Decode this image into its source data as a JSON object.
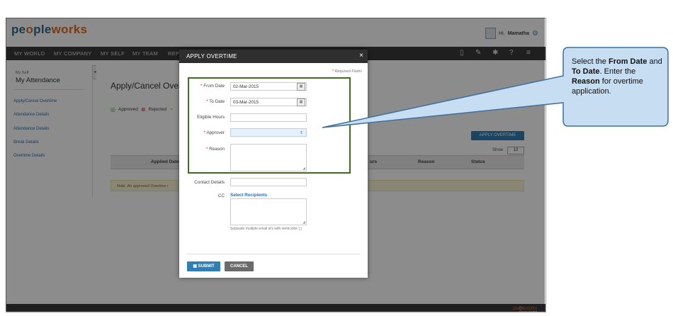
{
  "app": {
    "logo_main": "pe",
    "logo_accent": "o",
    "logo_rest": "ple",
    "logo_end": "works",
    "user_greeting": "Hi,",
    "user_name": "Mamatha"
  },
  "nav": {
    "items": [
      "MY WORLD",
      "MY COMPANY",
      "MY SELF",
      "MY TEAM",
      "REPO"
    ],
    "icons": [
      "book-icon",
      "pin-icon",
      "tools-icon",
      "help-icon",
      "menu-icon"
    ]
  },
  "sidebar": {
    "sub": "My Self",
    "title": "My Attendance",
    "links": [
      "Apply/Cancel Overtime",
      "Attendance Details",
      "Attendance Details",
      "Break Details",
      "Overtime Details"
    ]
  },
  "main": {
    "page_title": "Apply/Cancel Overti",
    "legend_approved": "Approved",
    "legend_rejected": "Rejected",
    "apply_button": "APPLY OVERTIME",
    "show_label": "Show",
    "show_value": "10",
    "columns": [
      "Applied Date",
      "urs",
      "Reason",
      "Status"
    ],
    "note": "Note: An approved Overtime r"
  },
  "footer": {
    "text": "© Copyright 2015",
    "brand": "peopleworks"
  },
  "modal": {
    "title": "APPLY OVERTIME",
    "close": "×",
    "required_note": "Required Fields",
    "from_date_label": "From Date",
    "from_date_value": "02-Mar-2015",
    "to_date_label": "To Date",
    "to_date_value": "03-Mar-2015",
    "eligible_hours_label": "Eligible Hours",
    "eligible_hours_value": "",
    "approver_label": "Approver",
    "approver_value": "",
    "reason_label": "Reason",
    "contact_label": "Contact Details",
    "cc_label": "CC",
    "cc_link": "Select Recipients",
    "cc_hint": "Separate multiple email id's with semicolon (;)",
    "submit": "SUBMIT",
    "cancel": "CANCEL"
  },
  "callout": {
    "p1": "Select the ",
    "b1": "From Date",
    "p2": " and ",
    "b2": "To Date",
    "p3": ". Enter the ",
    "b3": "Reason",
    "p4": " for overtime application."
  },
  "colors": {
    "nav_bg": "#3a3a3a",
    "accent_blue": "#2e7fb5",
    "highlight_green": "#3e6e20",
    "callout_fill": "#c6ddf2",
    "callout_border": "#3f6f9e"
  }
}
